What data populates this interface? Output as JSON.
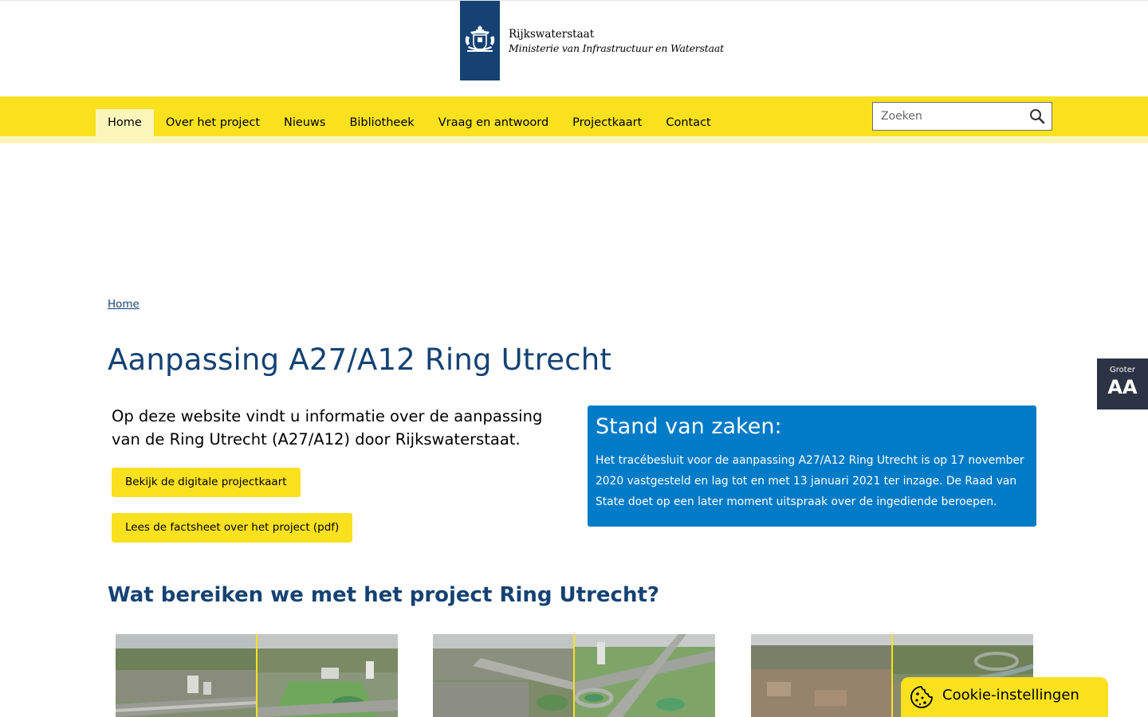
{
  "header": {
    "org_name": "Rijkswaterstaat",
    "ministry": "Ministerie van Infrastructuur en Waterstaat"
  },
  "nav": {
    "items": [
      {
        "label": "Home",
        "active": true
      },
      {
        "label": "Over het project",
        "active": false
      },
      {
        "label": "Nieuws",
        "active": false
      },
      {
        "label": "Bibliotheek",
        "active": false
      },
      {
        "label": "Vraag en antwoord",
        "active": false
      },
      {
        "label": "Projectkaart",
        "active": false
      },
      {
        "label": "Contact",
        "active": false
      }
    ]
  },
  "search": {
    "placeholder": "Zoeken",
    "icon": "search-icon"
  },
  "breadcrumb": {
    "home": "Home"
  },
  "page": {
    "title": "Aanpassing A27/A12 Ring Utrecht",
    "intro": "Op deze website vindt u informatie over de aanpassing van de Ring Utrecht (A27/A12) door Rijkswaterstaat.",
    "button_projectkaart": "Bekijk de digitale projectkaart",
    "button_factsheet": "Lees de factsheet over het project (pdf)",
    "subheading": "Wat bereiken we met het project Ring Utrecht?"
  },
  "status": {
    "title": "Stand van zaken:",
    "text": "Het tracébesluit voor de aanpassing A27/A12 Ring Utrecht is op 17 november 2020 vastgesteld en lag tot en met 13 januari 2021 ter inzage. De Raad van State doet op een later moment uitspraak over de ingediende beroepen."
  },
  "accessibility": {
    "groter_small": "Groter",
    "groter_big": "AA"
  },
  "cookie": {
    "label": "Cookie-instellingen",
    "icon": "cookie-icon"
  },
  "colors": {
    "brand_blue": "#154273",
    "yellow": "#f9e11e",
    "light_yellow": "#fdf6bb",
    "status_blue": "#007bc7",
    "dark_panel": "#2c3345"
  }
}
